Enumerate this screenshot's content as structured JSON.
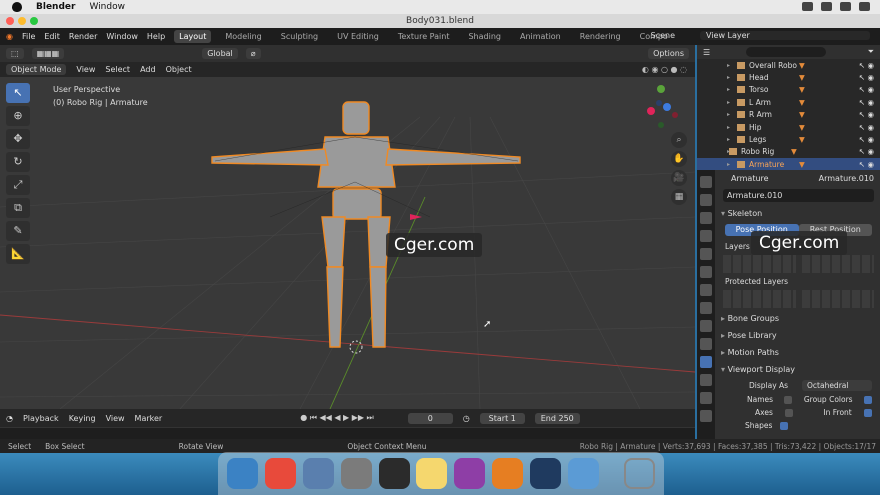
{
  "mac_menu": {
    "app": "Blender",
    "items": [
      "Window"
    ]
  },
  "window_title": "Body031.blend",
  "topbar": {
    "menus": [
      "File",
      "Edit",
      "Render",
      "Window",
      "Help"
    ],
    "workspaces": [
      "Layout",
      "Modeling",
      "Sculpting",
      "UV Editing",
      "Texture Paint",
      "Shading",
      "Animation",
      "Rendering",
      "Compo"
    ],
    "scene": "Scene",
    "view_layer": "View Layer"
  },
  "vp_header": {
    "transform": "Global",
    "options": "Options",
    "mode": "Object Mode",
    "menus": [
      "View",
      "Select",
      "Add",
      "Object"
    ]
  },
  "viewport": {
    "perspective": "User Perspective",
    "active": "(0) Robo Rig | Armature"
  },
  "watermark": "Cger.com",
  "timeline": {
    "menus": [
      "Playback",
      "Keying",
      "View",
      "Marker"
    ],
    "current": "0",
    "start_label": "Start",
    "start": "1",
    "end_label": "End",
    "end": "250"
  },
  "statusbar": {
    "select": "Select",
    "box": "Box Select",
    "rotate": "Rotate View",
    "context": "Object Context Menu",
    "stats": "Robo Rig | Armature | Verts:37,693 | Faces:37,385 | Tris:73,422 | Objects:17/17"
  },
  "outliner": {
    "items": [
      {
        "label": "Overall Robo",
        "child": true
      },
      {
        "label": "Head",
        "child": true
      },
      {
        "label": "Torso",
        "child": true
      },
      {
        "label": "L Arm",
        "child": true
      },
      {
        "label": "R Arm",
        "child": true
      },
      {
        "label": "Hip",
        "child": true
      },
      {
        "label": "Legs",
        "child": true
      },
      {
        "label": "Robo Rig",
        "child": false
      },
      {
        "label": "Armature",
        "child": true,
        "selected": true
      }
    ]
  },
  "props": {
    "header_left": "Armature",
    "header_right": "Armature.010",
    "name": "Armature.010",
    "skeleton": "Skeleton",
    "pose_position": "Pose Position",
    "rest_position": "Rest Position",
    "layers": "Layers",
    "protected": "Protected Layers",
    "bone_groups": "Bone Groups",
    "pose_library": "Pose Library",
    "motion_paths": "Motion Paths",
    "viewport_display": "Viewport Display",
    "display_as_label": "Display As",
    "display_as": "Octahedral",
    "names": "Names",
    "group_colors": "Group Colors",
    "axes": "Axes",
    "in_front": "In Front",
    "shapes": "Shapes"
  },
  "colors": {
    "accent": "#4772b3",
    "selection": "#f08a24",
    "dock": [
      "#3b82c4",
      "#e84a3b",
      "#5a7fae",
      "#7b7b7b",
      "#2b2b2b",
      "#f5d76e",
      "#8e3ea6",
      "#e67e22",
      "#1f3a5f",
      "#5b9bd5",
      "#888888"
    ]
  }
}
